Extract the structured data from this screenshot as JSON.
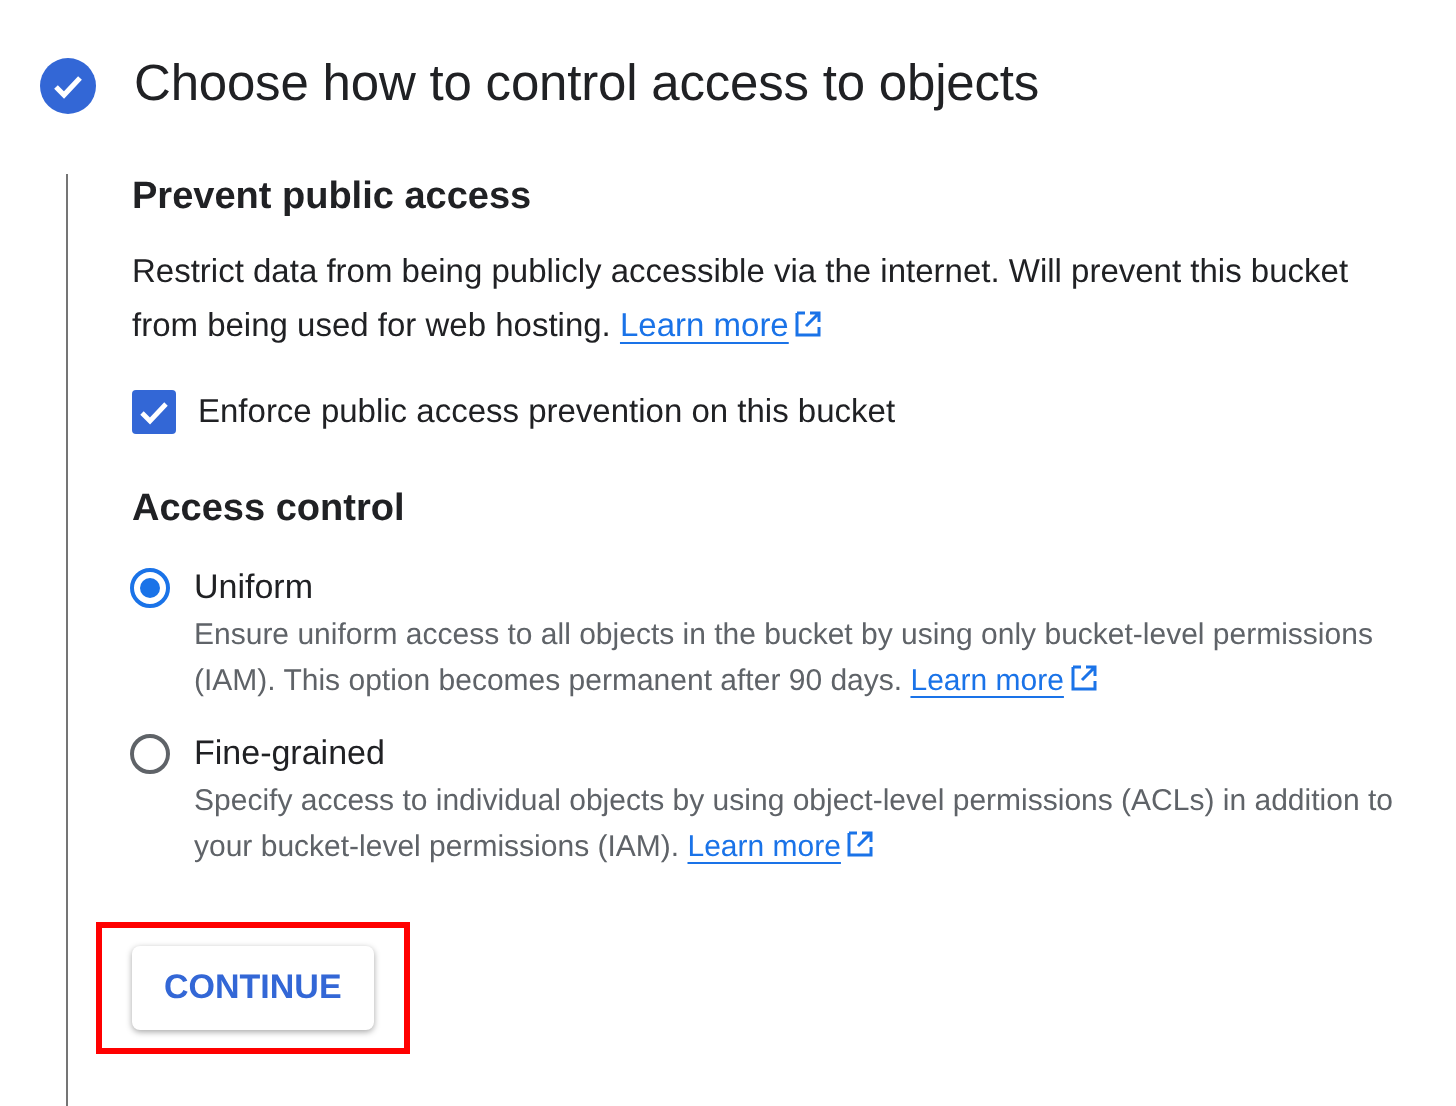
{
  "step": {
    "title": "Choose how to control access to objects",
    "completed": true
  },
  "public_access": {
    "heading": "Prevent public access",
    "description": "Restrict data from being publicly accessible via the internet. Will prevent this bucket from being used for web hosting.",
    "link": "Learn more",
    "checkbox": {
      "label": "Enforce public access prevention on this bucket",
      "checked": true
    }
  },
  "access_control": {
    "heading": "Access control",
    "options": [
      {
        "label": "Uniform",
        "selected": true,
        "description": "Ensure uniform access to all objects in the bucket by using only bucket-level permissions (IAM). This option becomes permanent after 90 days.",
        "link": "Learn more"
      },
      {
        "label": "Fine-grained",
        "selected": false,
        "description": "Specify access to individual objects by using object-level permissions (ACLs) in addition to your bucket-level permissions (IAM).",
        "link": "Learn more"
      }
    ]
  },
  "button": {
    "label": "CONTINUE",
    "highlighted": true
  }
}
